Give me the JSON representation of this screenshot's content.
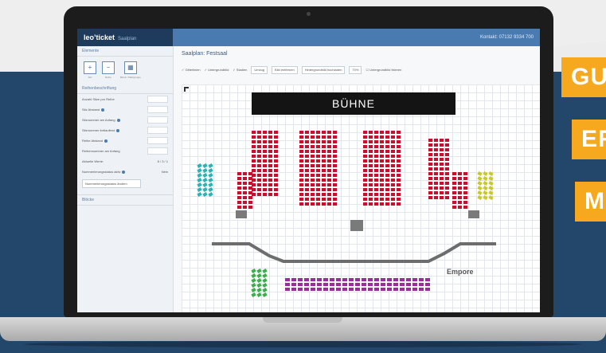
{
  "banner": {
    "lines": [
      "GU",
      "ER",
      "M"
    ],
    "color": "#f6a81f"
  },
  "app": {
    "logo": "leo’ticket",
    "logo_sub": "Saalplan",
    "hotline": "Kontakt: 07132 9334 700"
  },
  "sidebar": {
    "section1": "Elemente",
    "tools": [
      {
        "icon": "plus-icon",
        "glyph": "+",
        "label": "Sitz"
      },
      {
        "icon": "minus-icon",
        "glyph": "−",
        "label": "Reihe"
      },
      {
        "icon": "grid-icon",
        "glyph": "▦",
        "label": "Block / Platzgruppe"
      }
    ],
    "section2": "Reihenbeschriftung",
    "fields": [
      {
        "label": "Anzahl Sitze pro Reihe",
        "value": ""
      },
      {
        "label": "Sitz Abstand",
        "value": ""
      },
      {
        "label": "Sitznummer am Anfang",
        "value": ""
      },
      {
        "label": "Sitznummer fortlaufend",
        "value": ""
      },
      {
        "label": "Reihe Abstand",
        "value": ""
      },
      {
        "label": "Reihennummer am Anfang",
        "value": ""
      }
    ],
    "aktuelle_werte_label": "Aktuelle Werte:",
    "aktuelle_werte_value": "8 / 3 / 1",
    "nummer_label": "Nummerierungsstatus aktiv",
    "nummer_value": "Nein",
    "btn": "Nummerierungsstatus ändern",
    "section3": "Blöcke"
  },
  "main": {
    "title": "Saalplan: Festsaal",
    "toolbar": [
      {
        "label": "Gitterlinien",
        "type": "check"
      },
      {
        "label": "Untergrundbild",
        "type": "check"
      },
      {
        "label": "Stadien",
        "type": "check"
      },
      {
        "label": "Umzug",
        "type": "button"
      },
      {
        "label": "Bild entfernen",
        "type": "button"
      },
      {
        "label": "Hintergrundbild hochladen",
        "type": "button"
      },
      {
        "label": "70%",
        "type": "button"
      },
      {
        "label": "Untergrundbild fixieren",
        "type": "check"
      }
    ],
    "stage_label": "BÜHNE",
    "empore_label": "Empore"
  },
  "colors": {
    "seat_parkett": "#c8102e",
    "seat_left": "#2bb3b3",
    "seat_right": "#c9c92a",
    "seat_front": "#3aae4a",
    "seat_empore": "#9c2c9c",
    "gallery_line": "#6d6d6d",
    "topbar": "#4a7bb0"
  }
}
